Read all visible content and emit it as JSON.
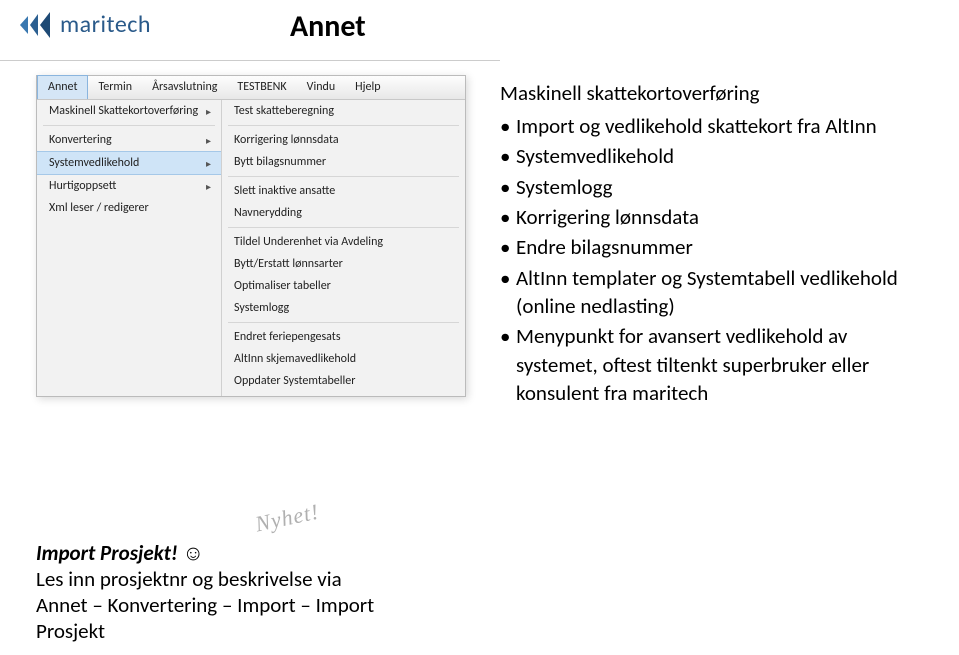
{
  "brand": {
    "name": "maritech"
  },
  "slide": {
    "title": "Annet"
  },
  "menubar": {
    "items": [
      {
        "label": "Annet",
        "active": true
      },
      {
        "label": "Termin"
      },
      {
        "label": "Årsavslutning"
      },
      {
        "label": "TESTBENK"
      },
      {
        "label": "Vindu"
      },
      {
        "label": "Hjelp"
      }
    ]
  },
  "left_menu": [
    {
      "label": "Maskinell Skattekortoverføring",
      "has_sub": true
    },
    {
      "sep": true
    },
    {
      "label": "Konvertering",
      "has_sub": true
    },
    {
      "label": "Systemvedlikehold",
      "has_sub": true,
      "highlight": true
    },
    {
      "label": "Hurtigoppsett",
      "has_sub": true
    },
    {
      "label": "Xml leser / redigerer"
    }
  ],
  "right_menu": [
    {
      "label": "Test skatteberegning"
    },
    {
      "sep": true
    },
    {
      "label": "Korrigering lønnsdata"
    },
    {
      "label": "Bytt bilagsnummer"
    },
    {
      "sep": true
    },
    {
      "label": "Slett inaktive ansatte"
    },
    {
      "label": "Navnerydding"
    },
    {
      "sep": true
    },
    {
      "label": "Tildel Underenhet via Avdeling"
    },
    {
      "label": "Bytt/Erstatt lønnsarter"
    },
    {
      "label": "Optimaliser tabeller"
    },
    {
      "label": "Systemlogg"
    },
    {
      "sep": true
    },
    {
      "label": "Endret feriepengesats"
    },
    {
      "label": "AltInn skjemavedlikehold"
    },
    {
      "label": "Oppdater Systemtabeller"
    }
  ],
  "content": {
    "heading": "Maskinell skattekortoverføring",
    "bullets": [
      "Import og vedlikehold skattekort fra AltInn",
      "Systemvedlikehold",
      "Systemlogg",
      "Korrigering lønnsdata",
      "Endre bilagsnummer",
      "AltInn templater og Systemtabell vedlikehold (online nedlasting)",
      "Menypunkt for avansert vedlikehold av systemet, oftest tiltenkt superbruker eller konsulent fra maritech"
    ]
  },
  "nyhet": "Nyhet!",
  "footer": {
    "title": "Import Prosjekt!",
    "smiley": "☺",
    "line1": "Les inn prosjektnr og beskrivelse via",
    "line2": "Annet – Konvertering – Import – Import Prosjekt"
  }
}
